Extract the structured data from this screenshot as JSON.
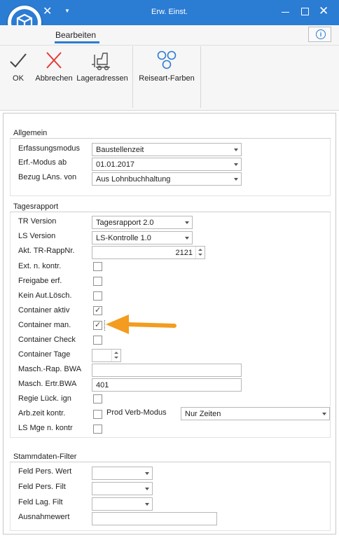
{
  "window": {
    "title": "Erw. Einst."
  },
  "ribbon": {
    "tab_label": "Bearbeiten",
    "info_label": "i",
    "buttons": [
      {
        "label": "OK",
        "icon": "checkmark-icon"
      },
      {
        "label": "Abbrechen",
        "icon": "cross-icon"
      },
      {
        "label": "Lageradressen",
        "icon": "forklift-icon"
      },
      {
        "label": "Reiseart-Farben",
        "icon": "circles-icon"
      }
    ]
  },
  "allgemein": {
    "title": "Allgemein",
    "erfassungsmodus": {
      "label": "Erfassungsmodus",
      "value": "Baustellenzeit"
    },
    "erf_modus_ab": {
      "label": "Erf.-Modus ab",
      "value": "01.01.2017"
    },
    "bezug_lans": {
      "label": "Bezug LAns. von",
      "value": "Aus Lohnbuchhaltung"
    }
  },
  "tagesrapport": {
    "title": "Tagesrapport",
    "tr_version": {
      "label": "TR Version",
      "value": "Tagesrapport 2.0"
    },
    "ls_version": {
      "label": "LS Version",
      "value": "LS-Kontrolle 1.0"
    },
    "akt_tr_rappnr": {
      "label": "Akt. TR-RappNr.",
      "value": "2121"
    },
    "ext_n_kontr": {
      "label": "Ext. n. kontr.",
      "checked": false
    },
    "freigabe_erf": {
      "label": "Freigabe erf.",
      "checked": false
    },
    "kein_aut_loesch": {
      "label": "Kein Aut.Lösch.",
      "checked": false
    },
    "container_aktiv": {
      "label": "Container aktiv",
      "checked": true
    },
    "container_man": {
      "label": "Container man.",
      "checked": true
    },
    "container_check": {
      "label": "Container Check",
      "checked": false
    },
    "container_tage": {
      "label": "Container Tage",
      "value": ""
    },
    "masch_rap_bwa": {
      "label": "Masch.-Rap. BWA",
      "value": ""
    },
    "masch_ertr_bwa": {
      "label": "Masch. Ertr.BWA",
      "value": "401"
    },
    "regie_lueck_ign": {
      "label": "Regie Lück. ign",
      "checked": false
    },
    "arb_zeit_kontr": {
      "label": "Arb.zeit kontr.",
      "checked": false
    },
    "prod_verb_modus": {
      "label": "Prod Verb-Modus",
      "value": "Nur Zeiten"
    },
    "ls_mge_n_kontr": {
      "label": "LS Mge n. kontr",
      "checked": false
    }
  },
  "stammdaten": {
    "title": "Stammdaten-Filter",
    "feld_pers_wert": {
      "label": "Feld Pers. Wert",
      "value": ""
    },
    "feld_pers_filt": {
      "label": "Feld Pers. Filt",
      "value": ""
    },
    "feld_lag_filt": {
      "label": "Feld Lag. Filt",
      "value": ""
    },
    "ausnahmewert": {
      "label": "Ausnahmewert",
      "value": ""
    }
  },
  "colors": {
    "accent": "#2b7cd3",
    "arrow": "#f39c1f"
  }
}
